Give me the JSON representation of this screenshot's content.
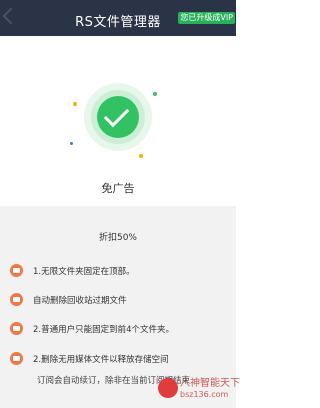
{
  "header": {
    "title": "RS文件管理器",
    "vip_badge": "您已升级成VIP"
  },
  "hero": {
    "label": "免广告"
  },
  "section": {
    "discount": "折扣50%",
    "features": [
      {
        "icon": "no-ads-icon",
        "text": "1.无限文件夹固定在顶部。"
      },
      {
        "icon": "recycle-bin-icon",
        "text": "自动删除回收站过期文件"
      },
      {
        "icon": "folder-pin-icon",
        "text": "2.普通用户只能固定到前4个文件夹。"
      },
      {
        "icon": "cleanup-icon",
        "text": "2.删除无用媒体文件以释放存储空间"
      }
    ],
    "footer": "订阅会自动续订，除非在当前订阅期结束"
  },
  "watermark": {
    "line1": "八神智能天下",
    "line2": "bsz136.com"
  },
  "colors": {
    "header_bg": "#2b3346",
    "accent_green": "#33c263",
    "icon_orange": "#f07846"
  }
}
